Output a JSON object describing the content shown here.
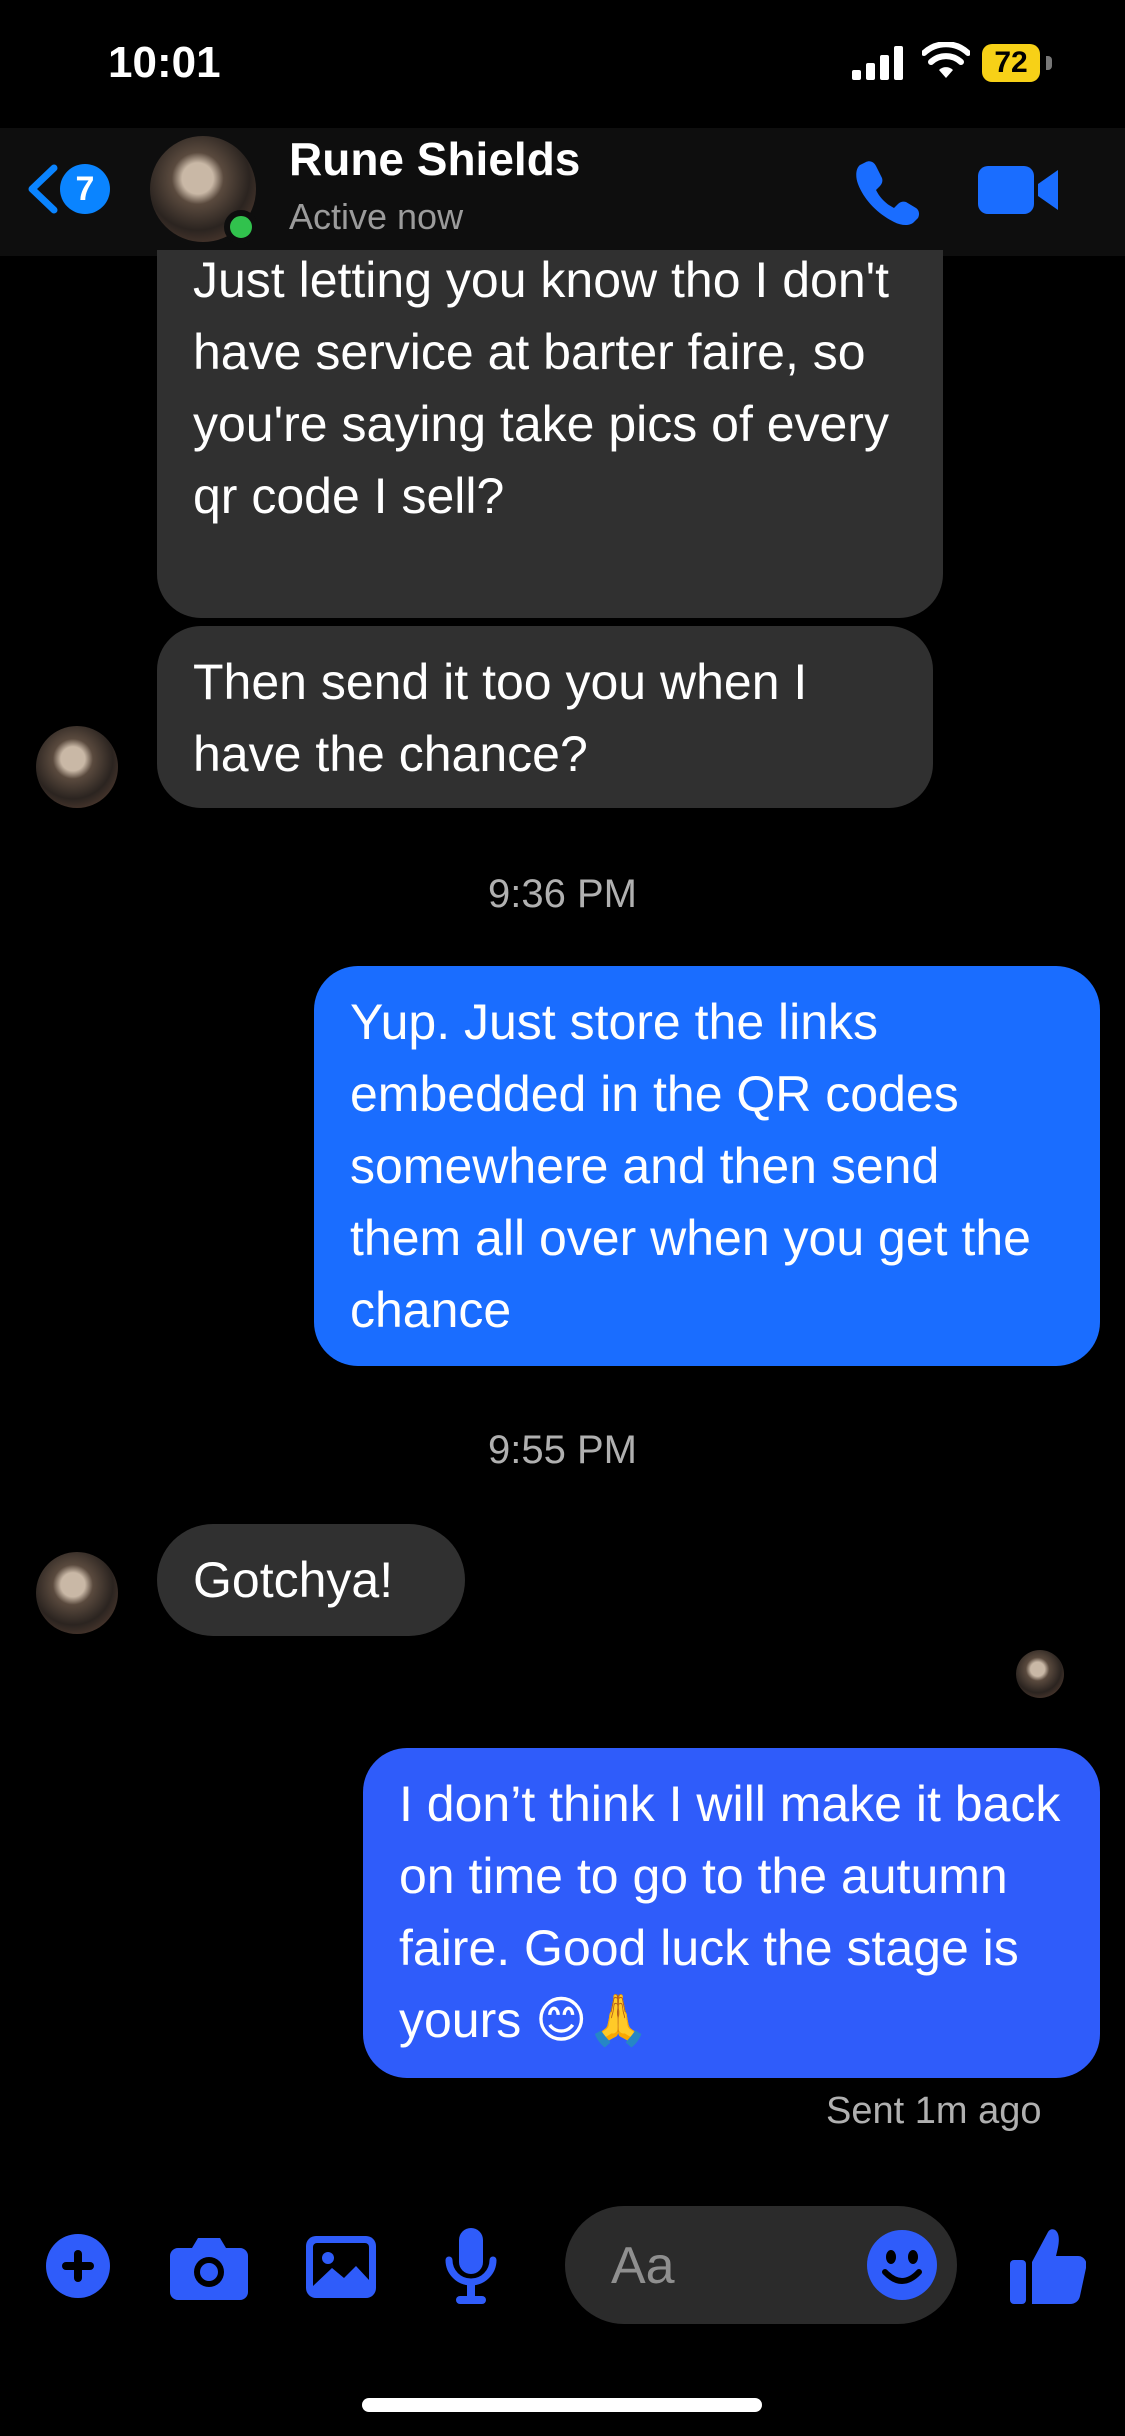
{
  "status_bar": {
    "time": "10:01",
    "battery": "72"
  },
  "header": {
    "back_badge": "7",
    "contact_name": "Rune Shields",
    "contact_status": "Active now",
    "icons": [
      "back-chevron-icon",
      "phone-icon",
      "video-camera-icon"
    ]
  },
  "messages": [
    {
      "sender": "them",
      "text": "Just letting you know tho I don't have service at barter faire, so you're saying take pics of every qr code I sell?"
    },
    {
      "sender": "them",
      "text": "Then send it too you when I have the chance?"
    },
    {
      "sender": "me",
      "text": "Yup. Just store the links embedded in the QR codes somewhere and then send them all over when you get the chance"
    },
    {
      "sender": "them",
      "text": "Gotchya!"
    },
    {
      "sender": "me",
      "text": "I don’t think I will make it back on time to go to the autumn faire. Good luck the stage is yours 😊🙏"
    }
  ],
  "timestamps": [
    "9:36 PM",
    "9:55 PM"
  ],
  "sent_status": "Sent 1m ago",
  "composer": {
    "placeholder": "Aa",
    "icons": [
      "plus-icon",
      "camera-icon",
      "gallery-icon",
      "microphone-icon",
      "emoji-icon",
      "thumbs-up-icon"
    ]
  },
  "colors": {
    "accent": "#1a6dff",
    "incoming_bubble": "#303030",
    "online": "#31c24d",
    "battery": "#f7d117"
  }
}
